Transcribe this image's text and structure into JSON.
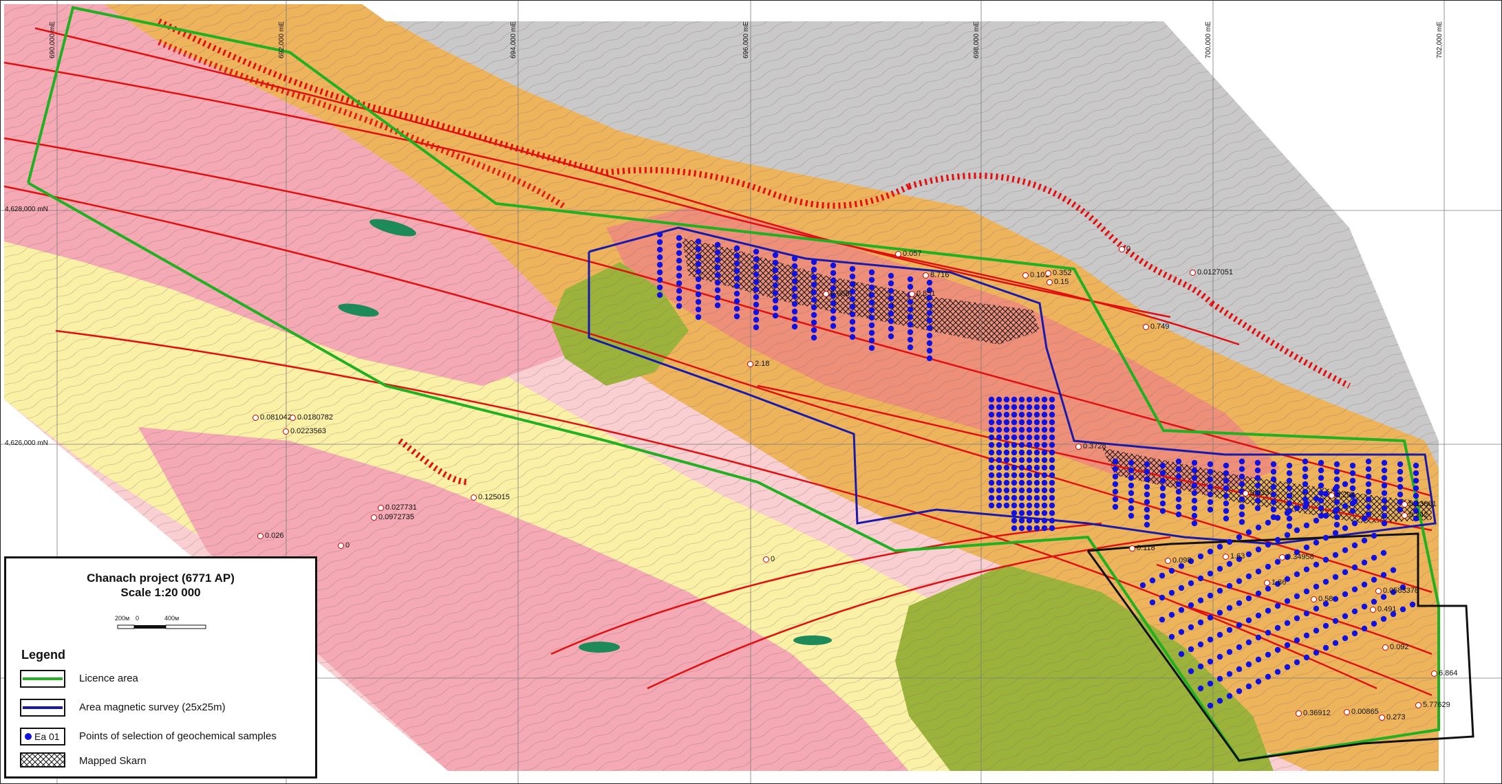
{
  "map": {
    "grid_easting_labels": [
      "690,000 mE",
      "692,000 mE",
      "694,000 mE",
      "696,000 mE",
      "698,000 mE",
      "700,000 mE",
      "702,000 mE"
    ],
    "grid_northing_labels": [
      "4,628,000 mN",
      "4,626,000 mN"
    ],
    "sample_values": [
      "0.057",
      "8.716",
      "0.101",
      "0.352",
      "0.15",
      "0.851",
      "0",
      "0.0127051",
      "0.749",
      "0.068",
      "2.18",
      "0.081042",
      "0.0180782",
      "0.0223563",
      "0.027731",
      "0.0972735",
      "0.125015",
      "0.026",
      "0",
      "0",
      "0.3728",
      "0.033",
      "0.294",
      "0.13801",
      "0.242",
      "0.098",
      "1.63",
      "0.34958",
      "1.86",
      "0.58",
      "0.0583378",
      "0.491",
      "0.092",
      "6.864",
      "0.36912",
      "0.00865",
      "5.77629",
      "0.273",
      "0.118"
    ],
    "colors": {
      "licence_area": "#22b022",
      "magnetic_survey": "#1a1aa8",
      "fault_lines": "#e01010",
      "sample_points": "#1212e0",
      "pink_unit": "#f4a9b5",
      "light_pink_unit": "#f9cfd2",
      "yellow_unit": "#fbf1a6",
      "orange_unit": "#eeb45c",
      "salmon_unit": "#ee8f7a",
      "olive_unit": "#9bb33a",
      "gray_unit": "#c9c9c9",
      "dark_green_unit": "#1e8a5a"
    }
  },
  "legend": {
    "project_title": "Chanach project  (6771 AP)",
    "scale_text": "Scale 1:20 000",
    "scale_bar_labels": [
      "200м",
      "0",
      "400м"
    ],
    "heading": "Legend",
    "items": [
      {
        "label": "Licence area",
        "symbol": "green-line"
      },
      {
        "label": "Area magnetic survey (25x25m)",
        "symbol": "blue-line"
      },
      {
        "label": "Points of selection of geochemical samples",
        "symbol": "blue-dot",
        "swatch_text": "Ea 01"
      },
      {
        "label": "Mapped Skarn",
        "symbol": "crosshatch"
      }
    ]
  }
}
